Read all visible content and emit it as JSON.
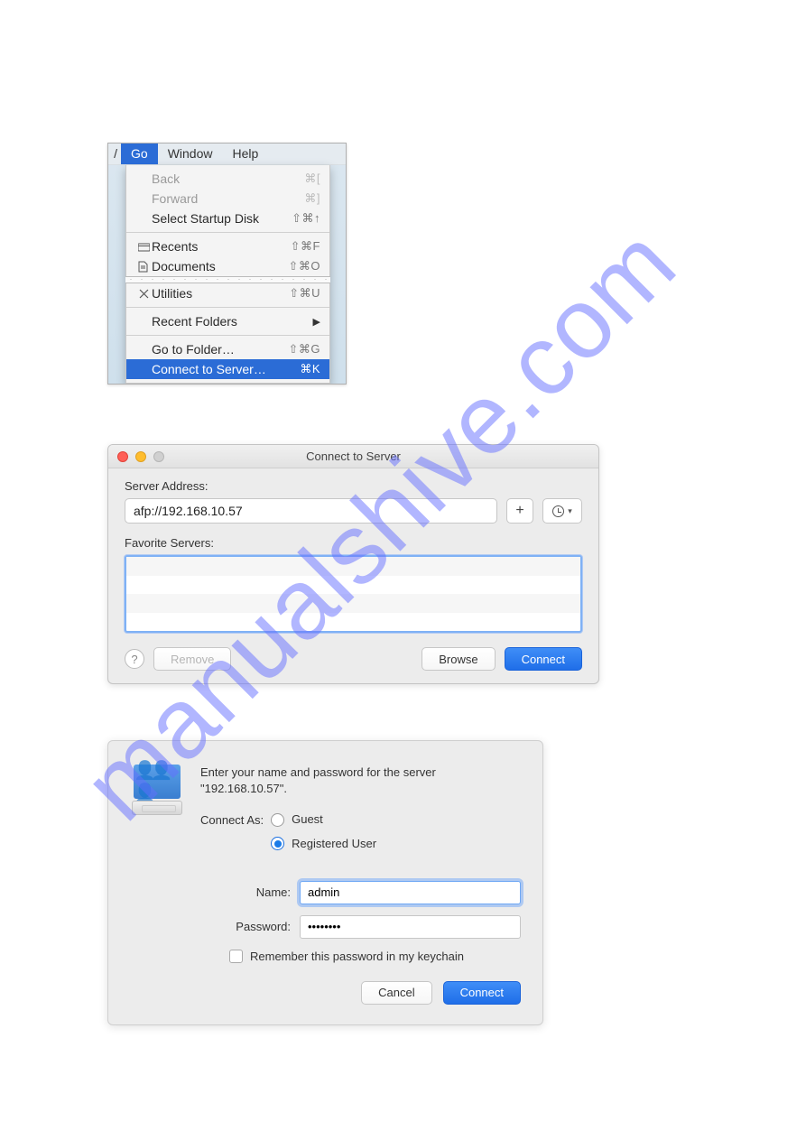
{
  "watermark": "manualshive.com",
  "menubar": {
    "partial": "/",
    "go": "Go",
    "window": "Window",
    "help": "Help"
  },
  "go_menu": {
    "back": {
      "label": "Back",
      "shortcut": "⌘["
    },
    "forward": {
      "label": "Forward",
      "shortcut": "⌘]"
    },
    "select_startup": {
      "label": "Select Startup Disk",
      "shortcut": "⇧⌘↑"
    },
    "recents": {
      "label": "Recents",
      "shortcut": "⇧⌘F"
    },
    "documents": {
      "label": "Documents",
      "shortcut": "⇧⌘O"
    },
    "utilities": {
      "label": "Utilities",
      "shortcut": "⇧⌘U"
    },
    "recent_folders": {
      "label": "Recent Folders"
    },
    "go_to_folder": {
      "label": "Go to Folder…",
      "shortcut": "⇧⌘G"
    },
    "connect_to_server": {
      "label": "Connect to Server…",
      "shortcut": "⌘K"
    }
  },
  "cts": {
    "title": "Connect to Server",
    "server_address_label": "Server Address:",
    "server_address_value": "afp://192.168.10.57",
    "favorite_servers_label": "Favorite Servers:",
    "remove": "Remove",
    "browse": "Browse",
    "connect": "Connect"
  },
  "auth": {
    "prompt_l1": "Enter your name and password for the server",
    "prompt_l2": "\"192.168.10.57\".",
    "connect_as_label": "Connect As:",
    "guest": "Guest",
    "registered": "Registered User",
    "name_label": "Name:",
    "name_value": "admin",
    "password_label": "Password:",
    "password_value": "••••••••",
    "remember": "Remember this password in my keychain",
    "cancel": "Cancel",
    "connect": "Connect"
  }
}
